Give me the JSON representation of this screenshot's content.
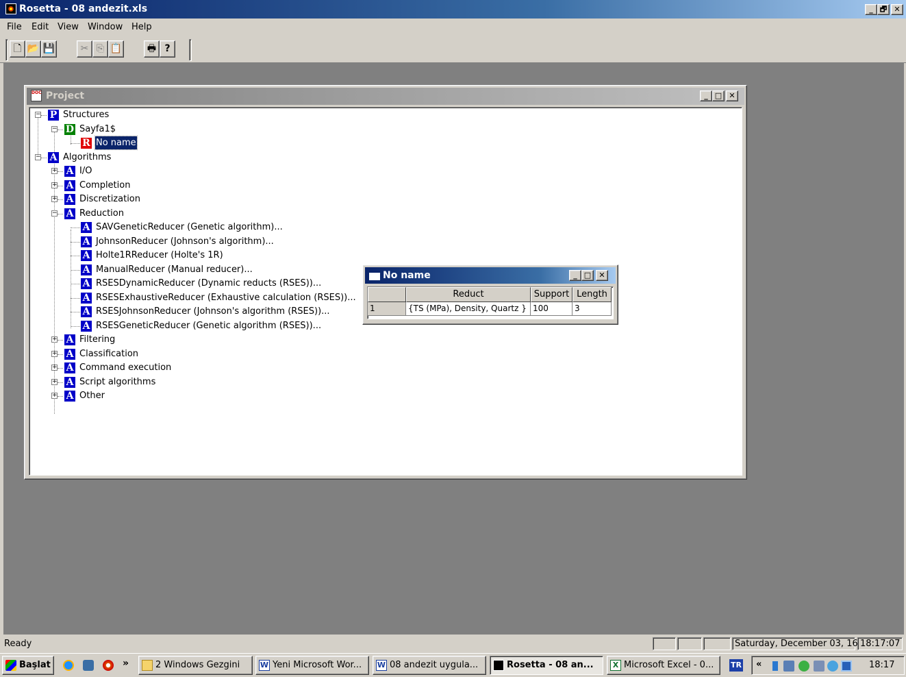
{
  "app": {
    "title": "Rosetta - 08 andezit.xls",
    "caption_buttons": {
      "minimize": "_",
      "restore": "🗗",
      "close": "✕"
    }
  },
  "menu": [
    "File",
    "Edit",
    "View",
    "Window",
    "Help"
  ],
  "toolbar": {
    "buttons": [
      {
        "name": "new-icon",
        "glyph": "🗋"
      },
      {
        "name": "open-icon",
        "glyph": "📂"
      },
      {
        "name": "save-icon",
        "glyph": "💾"
      },
      {
        "name": "cut-icon",
        "glyph": "✂"
      },
      {
        "name": "copy-icon",
        "glyph": "⎘"
      },
      {
        "name": "paste-icon",
        "glyph": "📋"
      },
      {
        "name": "print-icon",
        "glyph": "🖶"
      },
      {
        "name": "help-icon",
        "glyph": "?"
      }
    ]
  },
  "project": {
    "title": "Project",
    "tree": {
      "structures": {
        "badge": "P",
        "label": "Structures"
      },
      "sayfa": {
        "badge": "D",
        "label": "Sayfa1$"
      },
      "noname": {
        "badge": "R",
        "label": "No name"
      },
      "algorithms": {
        "badge": "A",
        "label": "Algorithms"
      },
      "groups_before": [
        {
          "badge": "A",
          "label": "I/O"
        },
        {
          "badge": "A",
          "label": "Completion"
        },
        {
          "badge": "A",
          "label": "Discretization"
        },
        {
          "badge": "A",
          "label": "Reduction"
        }
      ],
      "reducers": [
        {
          "badge": "A",
          "label": "SAVGeneticReducer (Genetic algorithm)..."
        },
        {
          "badge": "A",
          "label": "JohnsonReducer (Johnson's algorithm)..."
        },
        {
          "badge": "A",
          "label": "Holte1RReducer (Holte's 1R)"
        },
        {
          "badge": "A",
          "label": "ManualReducer (Manual reducer)..."
        },
        {
          "badge": "A",
          "label": "RSESDynamicReducer (Dynamic reducts (RSES))..."
        },
        {
          "badge": "A",
          "label": "RSESExhaustiveReducer (Exhaustive calculation (RSES))..."
        },
        {
          "badge": "A",
          "label": "RSESJohnsonReducer (Johnson's algorithm (RSES))..."
        },
        {
          "badge": "A",
          "label": "RSESGeneticReducer (Genetic algorithm (RSES))..."
        }
      ],
      "groups_after": [
        {
          "badge": "A",
          "label": "Filtering"
        },
        {
          "badge": "A",
          "label": "Classification"
        },
        {
          "badge": "A",
          "label": "Command execution"
        },
        {
          "badge": "A",
          "label": "Script algorithms"
        },
        {
          "badge": "A",
          "label": "Other"
        }
      ]
    }
  },
  "reduct_window": {
    "title": "No name",
    "columns": [
      "Reduct",
      "Support",
      "Length"
    ],
    "rows": [
      {
        "index": "1",
        "reduct": "{TS (MPa), Density, Quartz }",
        "support": "100",
        "length": "3"
      }
    ]
  },
  "status": {
    "text": "Ready",
    "date": "Saturday, December 03, 16",
    "time": "18:17:07"
  },
  "taskbar": {
    "start": "Başlat",
    "chevron": "»",
    "buttons": [
      {
        "label": "2 Windows Gezgini",
        "icon": "folder-icon"
      },
      {
        "label": "Yeni Microsoft Wor...",
        "icon": "word-icon"
      },
      {
        "label": "08 andezit uygula...",
        "icon": "word-icon"
      },
      {
        "label": "Rosetta - 08 an...",
        "icon": "rosetta-icon"
      },
      {
        "label": "Microsoft Excel - 0...",
        "icon": "excel-icon"
      }
    ],
    "language": "TR",
    "tray_chevron": "«",
    "clock": "18:17"
  },
  "colors": {
    "title_active": "#0a246a",
    "badge_blue": "#0000c8",
    "badge_green": "#008000",
    "badge_red": "#e00000",
    "mdi_background": "#808080"
  }
}
